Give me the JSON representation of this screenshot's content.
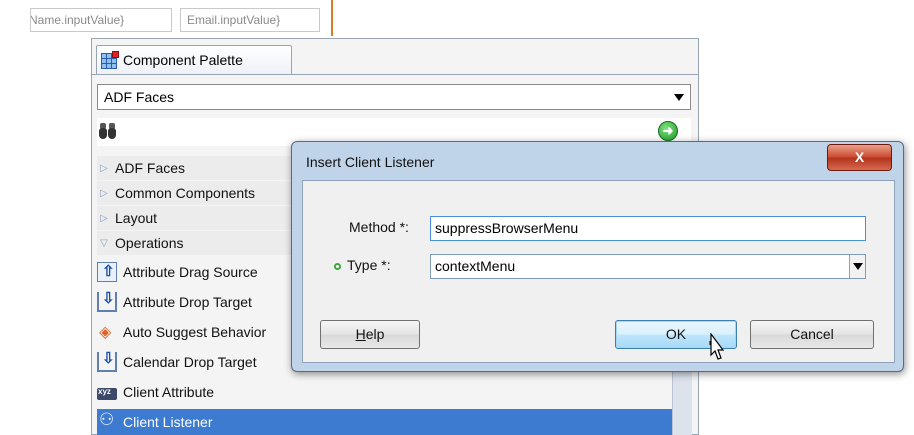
{
  "top_fields": [
    {
      "value": "Name.inputValue}"
    },
    {
      "value": "Email.inputValue}"
    }
  ],
  "palette": {
    "tab_label": "Component Palette",
    "library_select": "ADF Faces",
    "categories": [
      {
        "label": "ADF Faces",
        "expanded": false
      },
      {
        "label": "Common Components",
        "expanded": false
      },
      {
        "label": "Layout",
        "expanded": false
      },
      {
        "label": "Operations",
        "expanded": true
      }
    ],
    "operations": [
      {
        "label": "Attribute Drag Source",
        "icon": "drag-source-icon"
      },
      {
        "label": "Attribute Drop Target",
        "icon": "drop-target-icon"
      },
      {
        "label": "Auto Suggest Behavior",
        "icon": "auto-suggest-icon"
      },
      {
        "label": "Calendar Drop Target",
        "icon": "drop-target-icon"
      },
      {
        "label": "Client Attribute",
        "icon": "client-attribute-icon"
      },
      {
        "label": "Client Listener",
        "icon": "client-listener-icon",
        "selected": true
      }
    ]
  },
  "dialog": {
    "title": "Insert Client Listener",
    "close_label": "X",
    "method_label": "Method *:",
    "method_value": "suppressBrowserMenu",
    "type_label": "Type *:",
    "type_value": "contextMenu",
    "help_label_prefix": "",
    "help_label_underline": "H",
    "help_label_rest": "elp",
    "ok_label": "OK",
    "cancel_label": "Cancel"
  },
  "colors": {
    "selection": "#3c7bcf",
    "dialog_frame": "#bfd3e9",
    "close_button": "#c9482e"
  }
}
